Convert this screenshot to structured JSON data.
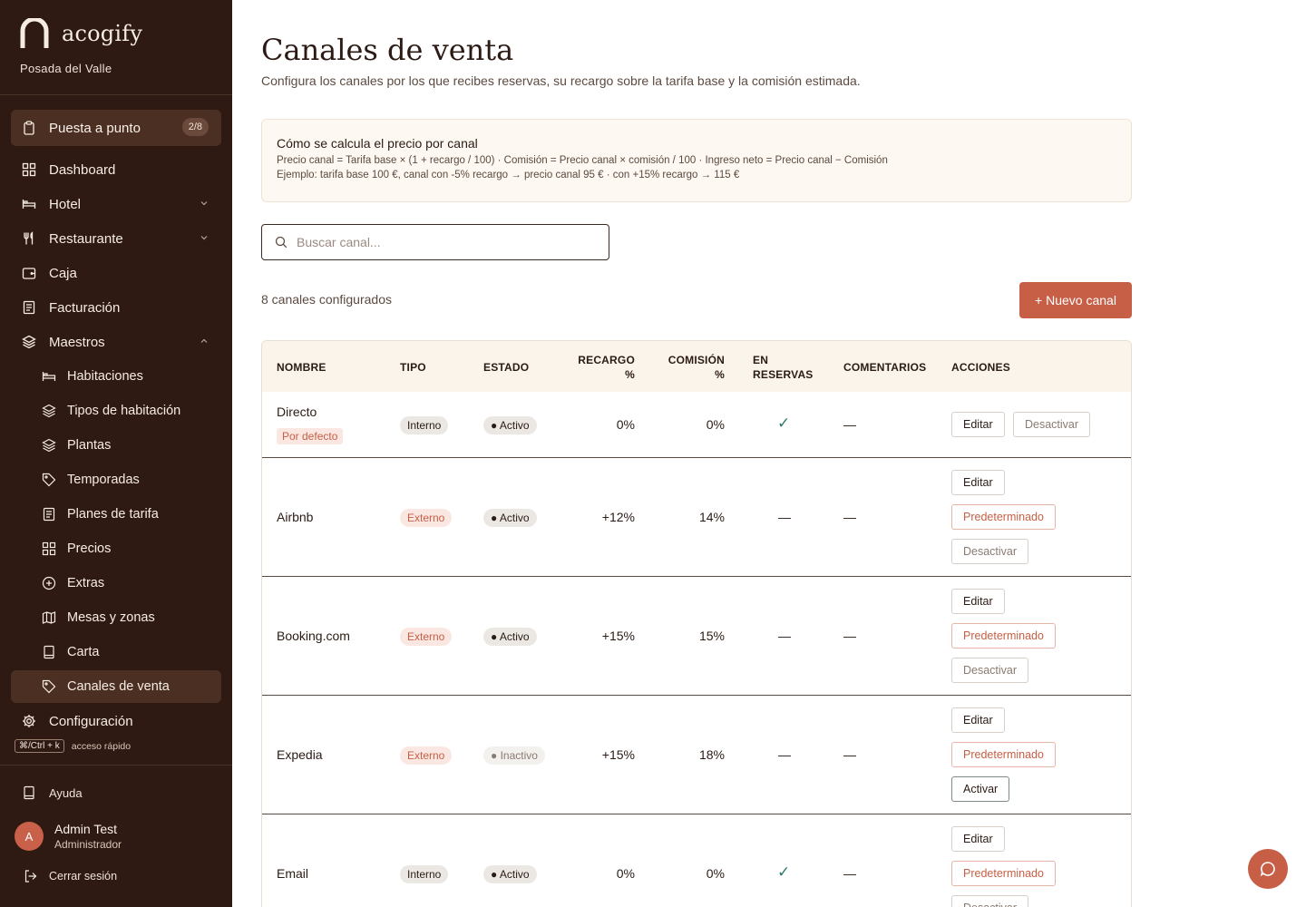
{
  "brand": {
    "name": "acogify",
    "hotel": "Posada del Valle"
  },
  "setup": {
    "label": "Puesta a punto",
    "progress": "2/8"
  },
  "nav": {
    "dashboard": "Dashboard",
    "hotel": "Hotel",
    "restaurante": "Restaurante",
    "caja": "Caja",
    "facturacion": "Facturación",
    "maestros": "Maestros",
    "habitaciones": "Habitaciones",
    "tipos": "Tipos de habitación",
    "plantas": "Plantas",
    "temporadas": "Temporadas",
    "planes": "Planes de tarifa",
    "precios": "Precios",
    "extras": "Extras",
    "mesas": "Mesas y zonas",
    "carta": "Carta",
    "canales": "Canales de venta",
    "configuracion": "Configuración"
  },
  "shortcut": {
    "keys": "⌘/Ctrl + k",
    "text": "acceso rápido"
  },
  "footer": {
    "help": "Ayuda",
    "user_initial": "A",
    "user_name": "Admin Test",
    "user_role": "Administrador",
    "logout": "Cerrar sesión"
  },
  "page": {
    "title": "Canales de venta",
    "subtitle": "Configura los canales por los que recibes reservas, su recargo sobre la tarifa base y la comisión estimada."
  },
  "info": {
    "heading": "Cómo se calcula el precio por canal",
    "formula": "Precio canal = Tarifa base × (1 + recargo / 100) · Comisión = Precio canal × comisión / 100 · Ingreso neto = Precio canal − Comisión",
    "example": "Ejemplo: tarifa base 100 €, canal con -5% recargo → precio canal 95 € · con +15% recargo → 115 €"
  },
  "search": {
    "placeholder": "Buscar canal..."
  },
  "summary": {
    "count": "8 canales configurados",
    "new_button": "+ Nuevo canal"
  },
  "table": {
    "headers": {
      "nombre": "NOMBRE",
      "tipo": "TIPO",
      "estado": "ESTADO",
      "recargo_1": "RECARGO",
      "recargo_2": "%",
      "comision_1": "COMISIÓN",
      "comision_2": "%",
      "reservas_1": "EN",
      "reservas_2": "RESERVAS",
      "comentarios": "COMENTARIOS",
      "acciones": "ACCIONES"
    },
    "default_tag": "Por defecto",
    "actions": {
      "edit": "Editar",
      "deactivate": "Desactivar",
      "default": "Predeterminado",
      "activate": "Activar"
    },
    "rows": [
      {
        "name": "Directo",
        "type": "Interno",
        "status": "Activo",
        "surcharge": "0%",
        "commission": "0%",
        "in_bookings": "✓",
        "comments": "—"
      },
      {
        "name": "Airbnb",
        "type": "Externo",
        "status": "Activo",
        "surcharge": "+12%",
        "commission": "14%",
        "in_bookings": "—",
        "comments": "—"
      },
      {
        "name": "Booking.com",
        "type": "Externo",
        "status": "Activo",
        "surcharge": "+15%",
        "commission": "15%",
        "in_bookings": "—",
        "comments": "—"
      },
      {
        "name": "Expedia",
        "type": "Externo",
        "status": "Inactivo",
        "surcharge": "+15%",
        "commission": "18%",
        "in_bookings": "—",
        "comments": "—"
      },
      {
        "name": "Email",
        "type": "Interno",
        "status": "Activo",
        "surcharge": "0%",
        "commission": "0%",
        "in_bookings": "✓",
        "comments": "—"
      }
    ]
  },
  "colors": {
    "sidebar": "#2e1a12",
    "accent": "#c65f45",
    "active_nav": "#4b2f23",
    "info_bg": "#fdf8f1"
  },
  "icons": [
    "logo-icon",
    "clipboard-icon",
    "grid-icon",
    "bed-icon",
    "utensils-icon",
    "wallet-icon",
    "receipt-icon",
    "layers-icon",
    "chevron-down-icon",
    "chevron-up-icon",
    "tag-icon",
    "plus-circle-icon",
    "map-icon",
    "book-icon",
    "gear-icon",
    "logout-icon",
    "search-icon",
    "chat-icon"
  ]
}
